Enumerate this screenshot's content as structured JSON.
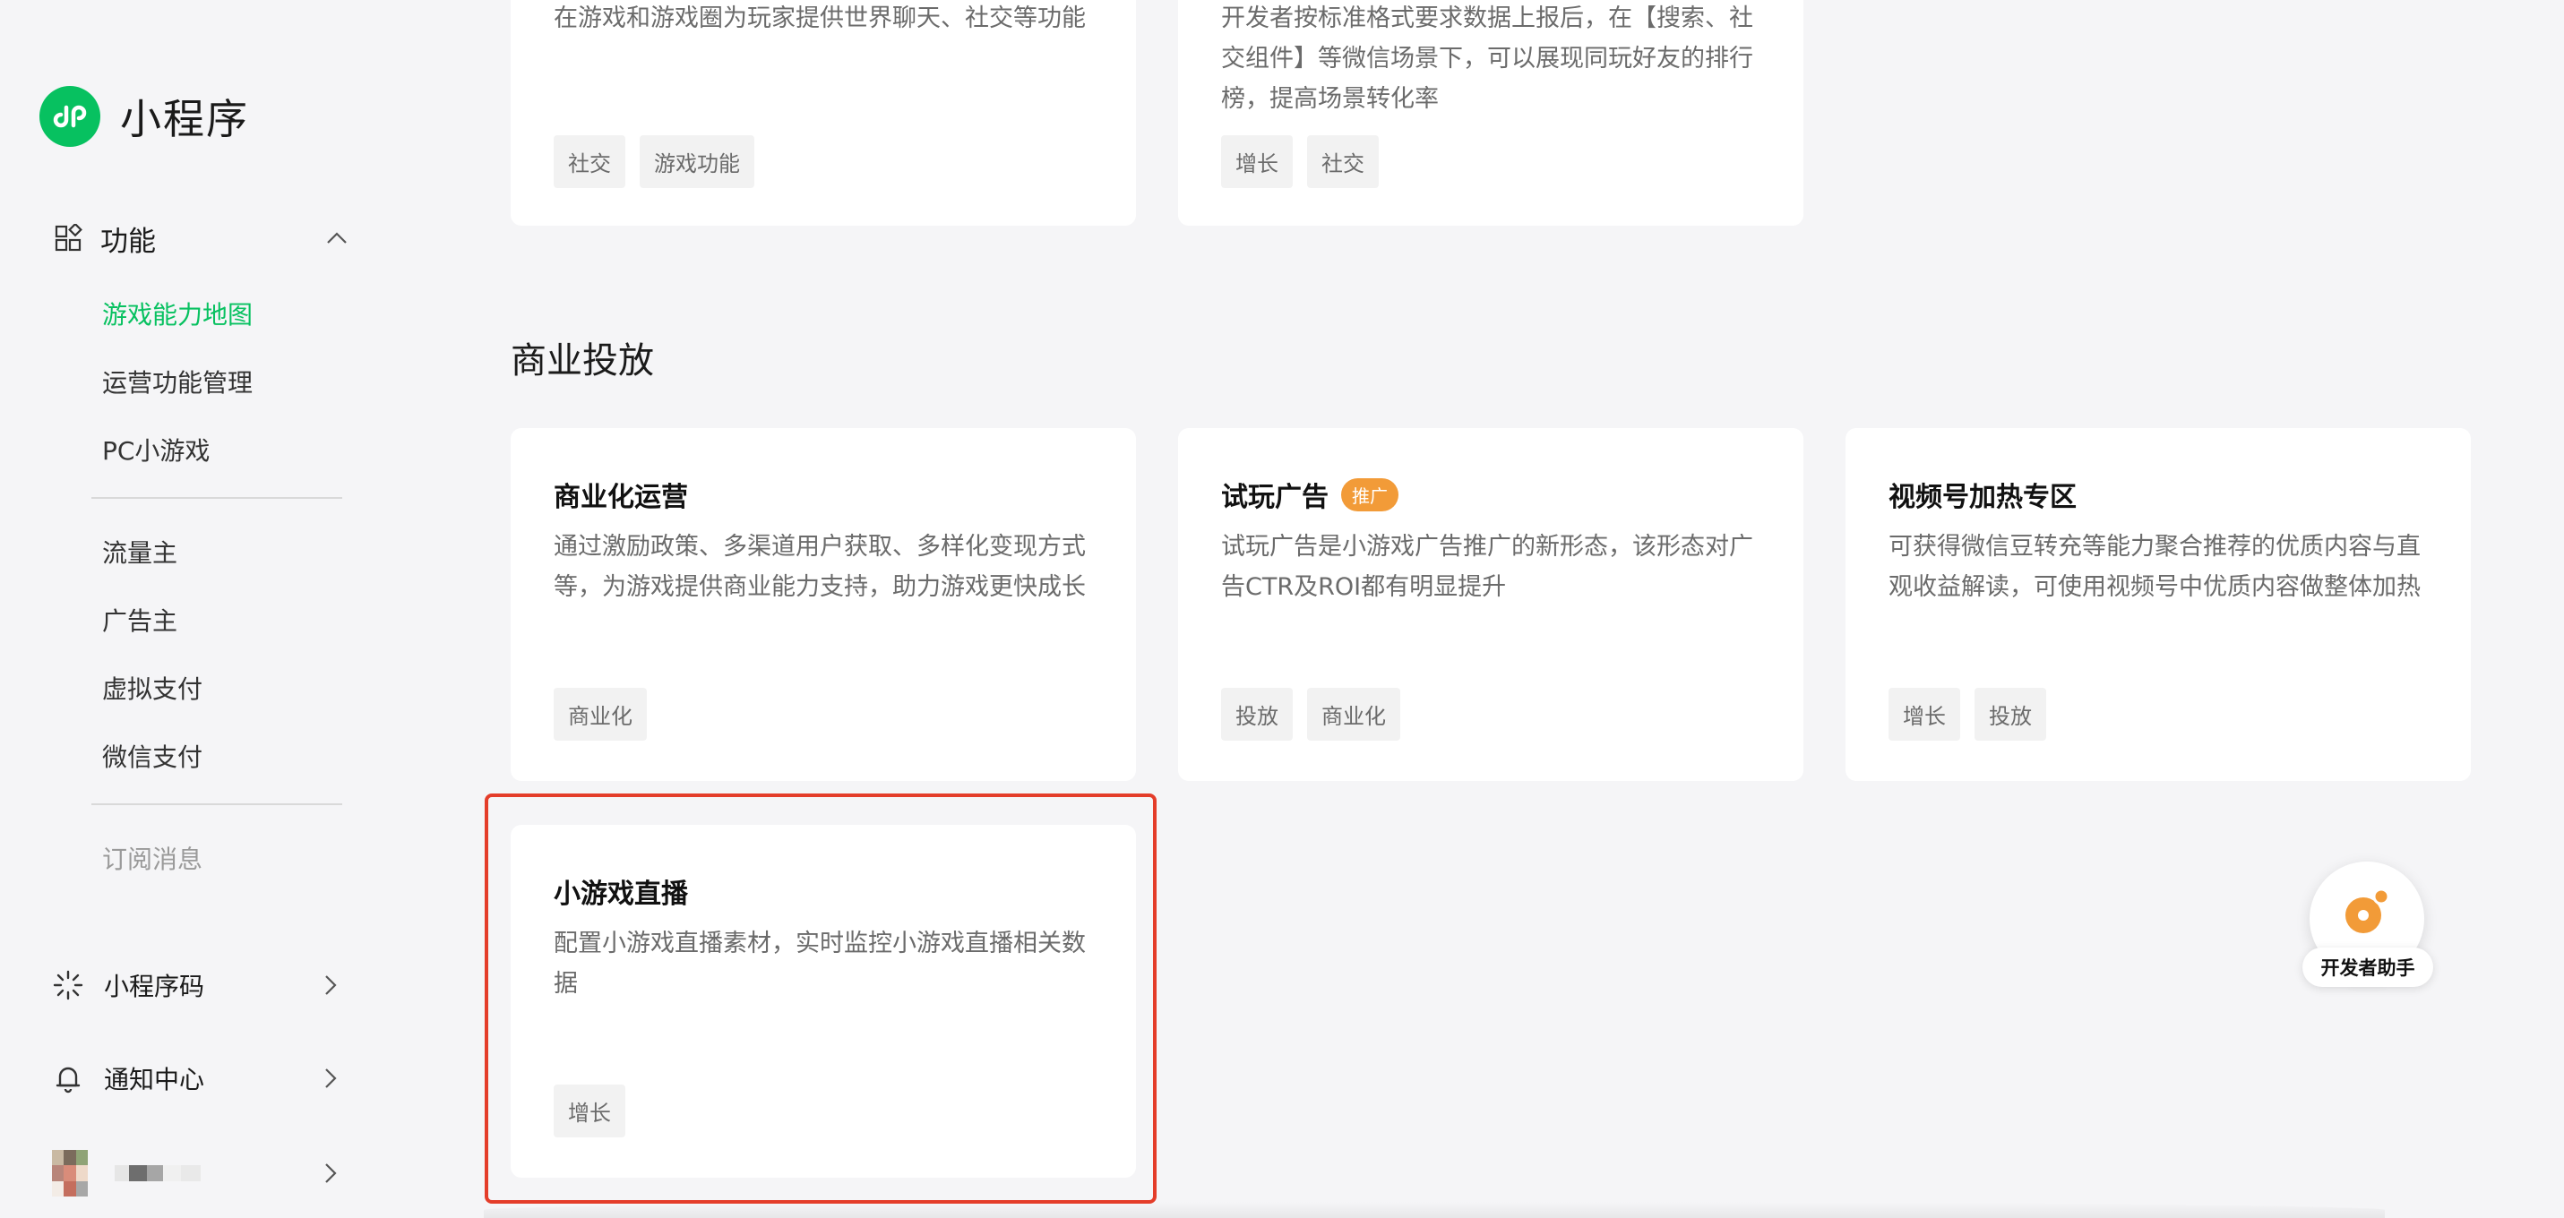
{
  "app": {
    "title": "小程序"
  },
  "sidebar": {
    "group": {
      "label": "功能"
    },
    "items": [
      {
        "label": "游戏能力地图",
        "active": true
      },
      {
        "label": "运营功能管理"
      },
      {
        "label": "PC小游戏"
      },
      {
        "label": "流量主"
      },
      {
        "label": "广告主"
      },
      {
        "label": "虚拟支付"
      },
      {
        "label": "微信支付"
      },
      {
        "label": "订阅消息"
      }
    ],
    "bottom": [
      {
        "label": "小程序码"
      },
      {
        "label": "通知中心"
      }
    ]
  },
  "top_cards": [
    {
      "desc": "在游戏和游戏圈为玩家提供世界聊天、社交等功能",
      "tags": [
        "社交",
        "游戏功能"
      ]
    },
    {
      "desc": "开发者按标准格式要求数据上报后，在【搜索、社交组件】等微信场景下，可以展现同玩好友的排行榜，提高场景转化率",
      "tags": [
        "增长",
        "社交"
      ]
    }
  ],
  "section": {
    "title": "商业投放"
  },
  "cards": [
    {
      "title": "商业化运营",
      "desc": "通过激励政策、多渠道用户获取、多样化变现方式等，为游戏提供商业能力支持，助力游戏更快成长",
      "tags": [
        "商业化"
      ]
    },
    {
      "title": "试玩广告",
      "badge": "推广",
      "desc": "试玩广告是小游戏广告推广的新形态，该形态对广告CTR及ROI都有明显提升",
      "tags": [
        "投放",
        "商业化"
      ]
    },
    {
      "title": "视频号加热专区",
      "desc": "可获得微信豆转充等能力聚合推荐的优质内容与直观收益解读，可使用视频号中优质内容做整体加热",
      "tags": [
        "增长",
        "投放"
      ]
    },
    {
      "title": "小游戏直播",
      "desc": "配置小游戏直播素材，实时监控小游戏直播相关数据",
      "tags": [
        "增长"
      ]
    }
  ],
  "helper": {
    "label": "开发者助手"
  },
  "colors": {
    "accent": "#07c160",
    "badge": "#f29b38",
    "highlight": "#e43d2a"
  }
}
